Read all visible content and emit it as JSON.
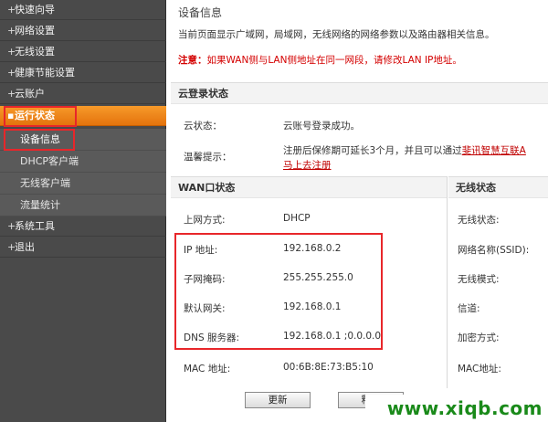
{
  "sidebar": {
    "items": [
      {
        "label": "快速向导"
      },
      {
        "label": "网络设置"
      },
      {
        "label": "无线设置"
      },
      {
        "label": "健康节能设置"
      },
      {
        "label": "云账户"
      },
      {
        "label": "运行状态"
      },
      {
        "label": "系统工具"
      },
      {
        "label": "退出"
      }
    ],
    "bullet": "+",
    "active_bullet": "▪",
    "sub_items": [
      {
        "label": "设备信息"
      },
      {
        "label": "DHCP客户端"
      },
      {
        "label": "无线客户端"
      },
      {
        "label": "流量统计"
      }
    ]
  },
  "main": {
    "title": "设备信息",
    "description": "当前页面显示广域网，局域网，无线网络的网络参数以及路由器相关信息。",
    "notice_prefix": "注意：",
    "notice_text": "如果WAN侧与LAN侧地址在同一网段，请修改LAN IP地址。",
    "cloud": {
      "heading": "云登录状态",
      "status_label": "云状态：",
      "status_value": "云账号登录成功。",
      "tip_label": "温馨提示：",
      "tip_text": "注册后保修期可延长3个月，并且可以通过",
      "tip_link": "斐讯智慧互联A",
      "register_link": "马上去注册"
    },
    "wan": {
      "heading": "WAN口状态",
      "rows": [
        {
          "label": "上网方式:",
          "value": "DHCP"
        },
        {
          "label": "IP 地址:",
          "value": "192.168.0.2"
        },
        {
          "label": "子网掩码:",
          "value": "255.255.255.0"
        },
        {
          "label": "默认网关:",
          "value": "192.168.0.1"
        },
        {
          "label": "DNS 服务器:",
          "value": "192.168.0.1 ;0.0.0.0"
        },
        {
          "label": "MAC 地址:",
          "value": "00:6B:8E:73:B5:10"
        }
      ]
    },
    "wireless": {
      "heading": "无线状态",
      "rows": [
        {
          "label": "无线状态:"
        },
        {
          "label": "网络名称(SSID):"
        },
        {
          "label": "无线模式:"
        },
        {
          "label": "信道:"
        },
        {
          "label": "加密方式:"
        },
        {
          "label": "MAC地址:"
        }
      ]
    },
    "buttons": {
      "refresh": "更新",
      "release": "释放"
    }
  },
  "watermark": "www.xiqb.com",
  "colors": {
    "sidebar_bg": "#4a4a4a",
    "active_orange": "#f08a1c",
    "highlight_red": "#e8262a",
    "notice_red": "#d40000",
    "watermark_green": "#1a8a1a"
  }
}
